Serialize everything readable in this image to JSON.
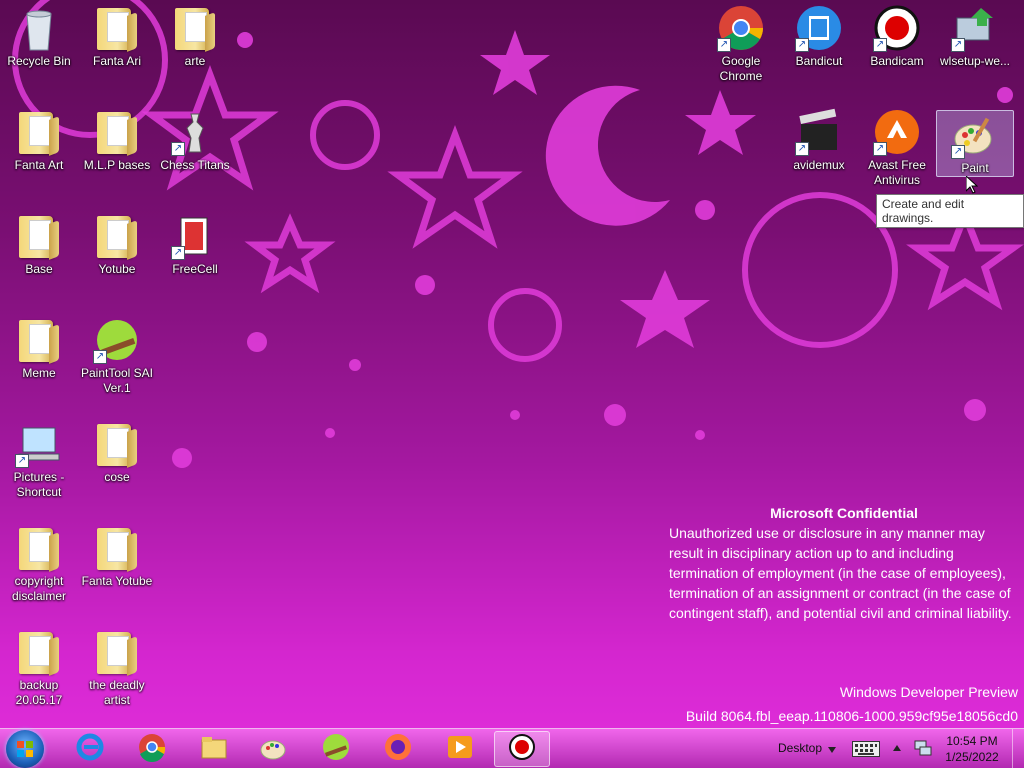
{
  "desktop_icons": [
    {
      "label": "Recycle Bin",
      "icon": "recycle-bin-icon"
    },
    {
      "label": "Fanta Ari",
      "icon": "folder-icon"
    },
    {
      "label": "arte",
      "icon": "folder-icon"
    },
    {
      "label": "Fanta Art",
      "icon": "folder-icon"
    },
    {
      "label": "M.L.P bases",
      "icon": "folder-icon"
    },
    {
      "label": "Chess Titans",
      "icon": "chess-icon"
    },
    {
      "label": "Base",
      "icon": "folder-icon"
    },
    {
      "label": "Yotube",
      "icon": "folder-icon"
    },
    {
      "label": "FreeCell",
      "icon": "cards-icon"
    },
    {
      "label": "Meme",
      "icon": "folder-icon"
    },
    {
      "label": "PaintTool SAI Ver.1",
      "icon": "painttool-sai-icon"
    },
    {
      "label": "Pictures - Shortcut",
      "icon": "pictures-shortcut-icon"
    },
    {
      "label": "cose",
      "icon": "folder-icon"
    },
    {
      "label": "copyright disclaimer",
      "icon": "folder-icon"
    },
    {
      "label": "Fanta Yotube",
      "icon": "folder-icon"
    },
    {
      "label": "backup 20.05.17",
      "icon": "folder-icon"
    },
    {
      "label": "the deadly artist",
      "icon": "folder-icon"
    },
    {
      "label": "Google Chrome",
      "icon": "chrome-icon"
    },
    {
      "label": "Bandicut",
      "icon": "bandicut-icon"
    },
    {
      "label": "Bandicam",
      "icon": "bandicam-icon"
    },
    {
      "label": "wlsetup-we...",
      "icon": "installer-icon"
    },
    {
      "label": "avidemux",
      "icon": "clapperboard-icon"
    },
    {
      "label": "Avast Free Antivirus",
      "icon": "avast-icon"
    },
    {
      "label": "Paint",
      "icon": "paint-palette-icon"
    }
  ],
  "tooltip": "Create and edit drawings.",
  "confidential": {
    "title": "Microsoft Confidential",
    "body": "Unauthorized use or disclosure in any manner may result in disciplinary action up to and including termination of employment (in the case of employees), termination of an assignment or contract (in the case of contingent staff), and potential civil and criminal liability."
  },
  "watermark": {
    "line1": "Windows Developer Preview",
    "line2": "Build 8064.fbl_eeap.110806-1000.959cf95e18056cd0"
  },
  "taskbar": {
    "pinned": [
      "internet-explorer-icon",
      "chrome-icon",
      "file-explorer-icon",
      "paint-palette-icon",
      "painttool-sai-icon",
      "firefox-icon",
      "media-player-icon",
      "bandicam-icon"
    ],
    "desktop_label": "Desktop",
    "time": "10:54 PM",
    "date": "1/25/2022"
  },
  "colors": {
    "accent": "#d426cf",
    "wallpaper_dark": "#5a0a52"
  }
}
